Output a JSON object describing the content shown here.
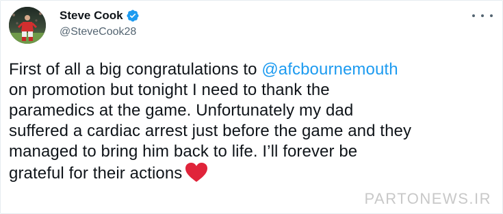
{
  "tweet": {
    "display_name": "Steve Cook",
    "handle": "@SteveCook28",
    "verified": true,
    "lines": [
      {
        "pre": "First of all a big congratulations to ",
        "mention": "@afcbournemouth"
      },
      {
        "text": "on promotion but tonight I need to thank the"
      },
      {
        "text": "paramedics at the game. Unfortunately my dad"
      },
      {
        "text": "suffered a cardiac arrest just before the game and they"
      },
      {
        "text": "managed to bring him back to life. I’ll forever be"
      },
      {
        "text": "grateful for their actions"
      }
    ],
    "emoji_icon": "red-heart-icon",
    "more_icon": "more-options-icon"
  },
  "watermark": "PARTONEWS.IR",
  "colors": {
    "mention": "#1d9bf0",
    "verified": "#1d9bf0",
    "heart": "#e0243a",
    "secondary_text": "#536471",
    "primary_text": "#0f1419"
  }
}
